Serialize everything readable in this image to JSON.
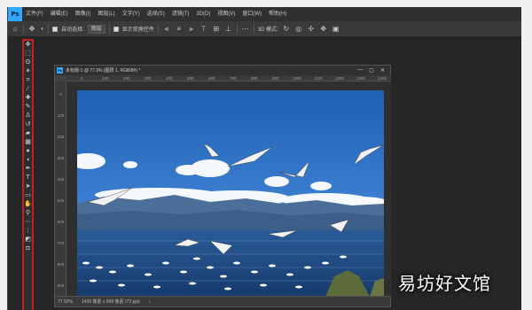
{
  "app": {
    "logo": "Ps"
  },
  "menu": [
    "文件(F)",
    "编辑(E)",
    "图像(I)",
    "图层(L)",
    "文字(Y)",
    "选择(S)",
    "滤镜(T)",
    "3D(D)",
    "视图(V)",
    "窗口(W)",
    "帮助(H)"
  ],
  "options": {
    "auto_select_label": "自动选择:",
    "auto_select_value": "图层",
    "transform_label": "显示变换控件"
  },
  "document": {
    "icon": "Ps",
    "title": "未标题-1 @ 77.9% (图层 1, RGB/8#) *",
    "ruler_top": [
      "0",
      "100",
      "200",
      "300",
      "400",
      "500",
      "600",
      "700",
      "800",
      "900",
      "1000",
      "1100",
      "1200",
      "1300",
      "1400"
    ],
    "ruler_left": [
      "0",
      "100",
      "200",
      "300",
      "400",
      "500",
      "600",
      "700",
      "800",
      "900"
    ],
    "status_zoom": "77.92%",
    "status_info": "1439 像素 x 999 像素 (72 ppi)"
  },
  "watermark": "易坊好文馆",
  "colors": {
    "ps_blue": "#31a8ff",
    "toolbar_highlight": "#c81e1e",
    "workspace": "#262626"
  },
  "toolbar_icons": [
    "move-tool-icon",
    "marquee-tool-icon",
    "lasso-tool-icon",
    "magic-wand-icon",
    "crop-tool-icon",
    "eyedropper-icon",
    "healing-brush-icon",
    "brush-tool-icon",
    "clone-stamp-icon",
    "history-brush-icon",
    "eraser-icon",
    "gradient-tool-icon",
    "blur-tool-icon",
    "dodge-tool-icon",
    "pen-tool-icon",
    "type-tool-icon",
    "path-select-icon",
    "shape-tool-icon",
    "hand-tool-icon",
    "zoom-tool-icon",
    "more-tools-icon",
    "color-swatches-icon"
  ]
}
